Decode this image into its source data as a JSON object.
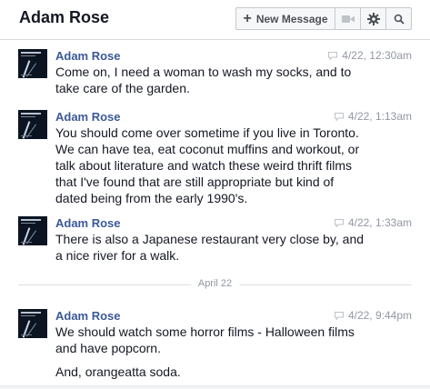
{
  "header": {
    "title": "Adam Rose",
    "new_message_label": "New Message",
    "icons": [
      "plus-icon",
      "video-call-icon",
      "gear-icon",
      "search-icon"
    ]
  },
  "messages": [
    {
      "sender": "Adam Rose",
      "time": "4/22, 12:30am",
      "paragraphs": [
        "Come on, I need a woman to wash my socks, and to take care of the garden."
      ]
    },
    {
      "sender": "Adam Rose",
      "time": "4/22, 1:13am",
      "paragraphs": [
        "You should come over sometime if you live in Toronto. We can have tea, eat coconut muffins and workout, or talk about literature and watch these weird thrift films that I've found that are still appropriate but kind of dated being from the early 1990's."
      ]
    },
    {
      "sender": "Adam Rose",
      "time": "4/22, 1:33am",
      "paragraphs": [
        "There is also a Japanese restaurant very close by, and a nice river for a walk."
      ]
    },
    {
      "sender": "Adam Rose",
      "time": "4/22, 9:44pm",
      "paragraphs": [
        "We should watch some horror films - Halloween films and have popcorn.",
        "And, orangeatta soda."
      ]
    }
  ],
  "date_divider": "April 22",
  "colors": {
    "sender": "#3b5998",
    "meta": "#9197a3",
    "text": "#141823",
    "divider": "#dddfe2"
  }
}
